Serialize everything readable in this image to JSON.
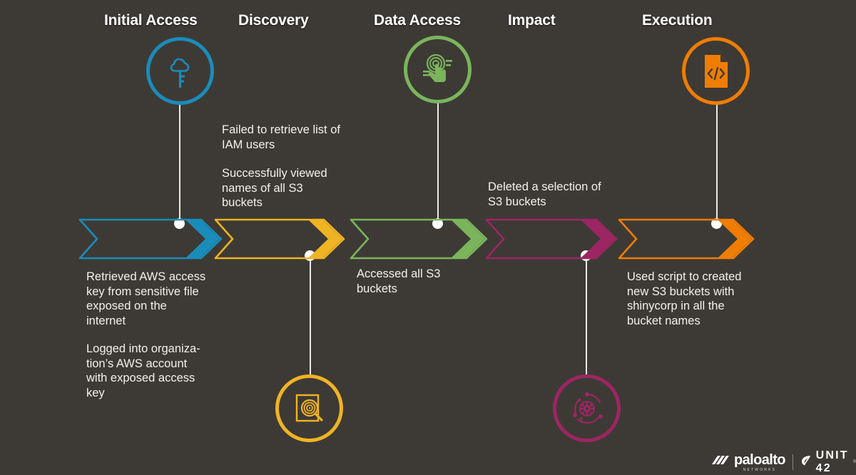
{
  "background_color": "#3d3a35",
  "stages": [
    {
      "id": "initial-access",
      "label": "Initial Access",
      "color": "#1a8cba",
      "icon": "cloud-key-icon",
      "icon_position": "top",
      "notes": [
        "Retrieved AWS access\nkey from sensitive file\nexposed on the\ninternet",
        "Logged into organiza-\ntion’s AWS account\nwith exposed access\nkey"
      ],
      "notes_position": "below"
    },
    {
      "id": "discovery",
      "label": "Discovery",
      "color": "#f0b323",
      "icon": "document-search-target-icon",
      "icon_position": "bottom",
      "notes": [
        "Failed to retrieve list of\nIAM users",
        "Successfully viewed\nnames of all S3\nbuckets"
      ],
      "notes_position": "above"
    },
    {
      "id": "data-access",
      "label": "Data Access",
      "color": "#7ab55c",
      "icon": "fingerprint-touch-icon",
      "icon_position": "top",
      "notes": [
        "Accessed all S3\nbuckets"
      ],
      "notes_position": "below"
    },
    {
      "id": "impact",
      "label": "Impact",
      "color": "#9e2563",
      "icon": "gear-cycle-icon",
      "icon_position": "bottom",
      "notes": [
        "Deleted a selection of\nS3 buckets"
      ],
      "notes_position": "above"
    },
    {
      "id": "execution",
      "label": "Execution",
      "color": "#ef7d00",
      "icon": "code-document-icon",
      "icon_position": "top",
      "notes": [
        "Used script to created\nnew S3 buckets with\nshinycorp in all the\nbucket names"
      ],
      "notes_position": "below"
    }
  ],
  "branding": {
    "vendor_name": "paloalto",
    "vendor_subtitle": "NETWORKS",
    "unit_name": "UNIT 42",
    "vendor_mark": "paloalto-logo-mark",
    "unit_mark": "unit42-logo-mark"
  }
}
